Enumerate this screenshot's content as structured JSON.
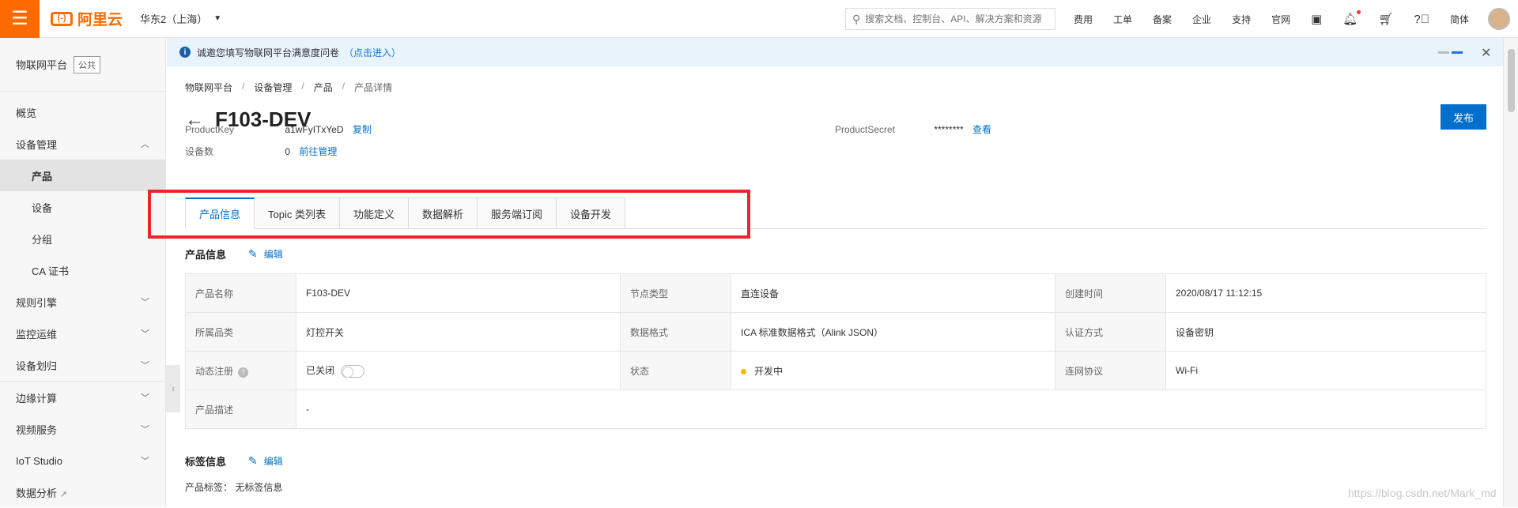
{
  "topbar": {
    "menu_icon": "☰",
    "logo_mark": "(-)",
    "logo_text": "阿里云",
    "region": "华东2（上海）",
    "search_placeholder": "搜索文档、控制台、API、解决方案和资源",
    "links": [
      "费用",
      "工单",
      "备案",
      "企业",
      "支持",
      "官网"
    ],
    "lang": "简体"
  },
  "sidebar": {
    "platform": "物联网平台",
    "badge": "公共",
    "items": [
      {
        "label": "概览"
      },
      {
        "label": "设备管理"
      },
      {
        "label": "产品"
      },
      {
        "label": "设备"
      },
      {
        "label": "分组"
      },
      {
        "label": "CA 证书"
      },
      {
        "label": "规则引擎"
      },
      {
        "label": "监控运维"
      },
      {
        "label": "设备划归"
      },
      {
        "label": "边缘计算"
      },
      {
        "label": "视频服务"
      },
      {
        "label": "IoT Studio"
      },
      {
        "label": "数据分析"
      }
    ]
  },
  "notice": {
    "text": "诚邀您填写物联网平台满意度问卷",
    "link": "（点击进入）"
  },
  "breadcrumb": [
    "物联网平台",
    "设备管理",
    "产品",
    "产品详情"
  ],
  "page": {
    "title": "F103-DEV",
    "publish_label": "发布",
    "product_key_label": "ProductKey",
    "product_key": "a1wFyITxYeD",
    "copy_label": "复制",
    "device_count_label": "设备数",
    "device_count": "0",
    "manage_label": "前往管理",
    "product_secret_label": "ProductSecret",
    "product_secret": "********",
    "view_label": "查看"
  },
  "tabs": [
    "产品信息",
    "Topic 类列表",
    "功能定义",
    "数据解析",
    "服务端订阅",
    "设备开发"
  ],
  "info_section": {
    "title": "产品信息",
    "edit_label": "编辑",
    "rows": [
      [
        {
          "k": "产品名称",
          "v": "F103-DEV"
        },
        {
          "k": "节点类型",
          "v": "直连设备"
        },
        {
          "k": "创建时间",
          "v": "2020/08/17 11:12:15"
        }
      ],
      [
        {
          "k": "所属品类",
          "v": "灯控开关"
        },
        {
          "k": "数据格式",
          "v": "ICA 标准数据格式（Alink JSON）"
        },
        {
          "k": "认证方式",
          "v": "设备密钥"
        }
      ],
      [
        {
          "k": "动态注册",
          "v": "已关闭"
        },
        {
          "k": "状态",
          "v": "开发中"
        },
        {
          "k": "连网协议",
          "v": "Wi-Fi"
        }
      ],
      [
        {
          "k": "产品描述",
          "v": "-"
        }
      ]
    ]
  },
  "tags_section": {
    "title": "标签信息",
    "edit_label": "编辑",
    "tags_label": "产品标签：",
    "tags_value": "无标签信息"
  },
  "watermark": "https://blog.csdn.net/Mark_md"
}
